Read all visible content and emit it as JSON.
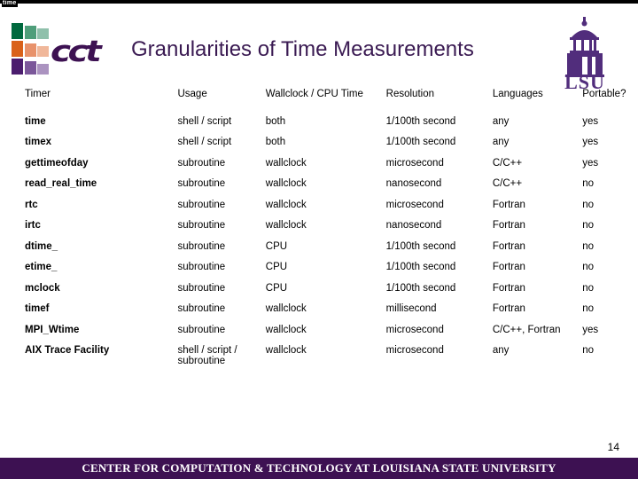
{
  "slide": {
    "tag_label": "time",
    "title": "Granularities of Time Measurements",
    "page_number": "14"
  },
  "branding": {
    "cct_wordmark": "cct",
    "lsu_wordmark": "LSU",
    "logo_colors": {
      "green_dark": "#00693e",
      "green_mid": "#4f9e7a",
      "green_light": "#8fc0ab",
      "orange_dark": "#d9611a",
      "orange_mid": "#e8926b",
      "orange_light": "#f0b79a",
      "purple_dark": "#4b1d6e",
      "purple_mid": "#7b579a",
      "purple_light": "#ab93c0",
      "brand_purple": "#3d1152",
      "title_purple": "#3a1a52",
      "lsu_purple": "#512d7c"
    }
  },
  "table": {
    "headers": [
      "Timer",
      "Usage",
      "Wallclock / CPU Time",
      "Resolution",
      "Languages",
      "Portable?"
    ],
    "rows": [
      {
        "timer": "time",
        "usage": "shell / script",
        "clock": "both",
        "resolution": "1/100th second",
        "languages": "any",
        "portable": "yes"
      },
      {
        "timer": "timex",
        "usage": "shell / script",
        "clock": "both",
        "resolution": "1/100th second",
        "languages": "any",
        "portable": "yes"
      },
      {
        "timer": "gettimeofday",
        "usage": "subroutine",
        "clock": "wallclock",
        "resolution": "microsecond",
        "languages": "C/C++",
        "portable": "yes"
      },
      {
        "timer": "read_real_time",
        "usage": "subroutine",
        "clock": "wallclock",
        "resolution": "nanosecond",
        "languages": "C/C++",
        "portable": "no"
      },
      {
        "timer": "rtc",
        "usage": "subroutine",
        "clock": "wallclock",
        "resolution": "microsecond",
        "languages": "Fortran",
        "portable": "no"
      },
      {
        "timer": "irtc",
        "usage": "subroutine",
        "clock": "wallclock",
        "resolution": "nanosecond",
        "languages": "Fortran",
        "portable": "no"
      },
      {
        "timer": "dtime_",
        "usage": "subroutine",
        "clock": "CPU",
        "resolution": "1/100th second",
        "languages": "Fortran",
        "portable": "no"
      },
      {
        "timer": "etime_",
        "usage": "subroutine",
        "clock": "CPU",
        "resolution": "1/100th second",
        "languages": "Fortran",
        "portable": "no"
      },
      {
        "timer": "mclock",
        "usage": "subroutine",
        "clock": "CPU",
        "resolution": "1/100th second",
        "languages": "Fortran",
        "portable": "no"
      },
      {
        "timer": "timef",
        "usage": "subroutine",
        "clock": "wallclock",
        "resolution": "millisecond",
        "languages": "Fortran",
        "portable": "no"
      },
      {
        "timer": "MPI_Wtime",
        "usage": "subroutine",
        "clock": "wallclock",
        "resolution": "microsecond",
        "languages": "C/C++, Fortran",
        "portable": "yes"
      },
      {
        "timer": "AIX Trace Facility",
        "usage": "shell / script / subroutine",
        "clock": "wallclock",
        "resolution": "microsecond",
        "languages": "any",
        "portable": "no"
      }
    ]
  },
  "footer": {
    "text": "Center for Computation & Technology at Louisiana State University"
  }
}
